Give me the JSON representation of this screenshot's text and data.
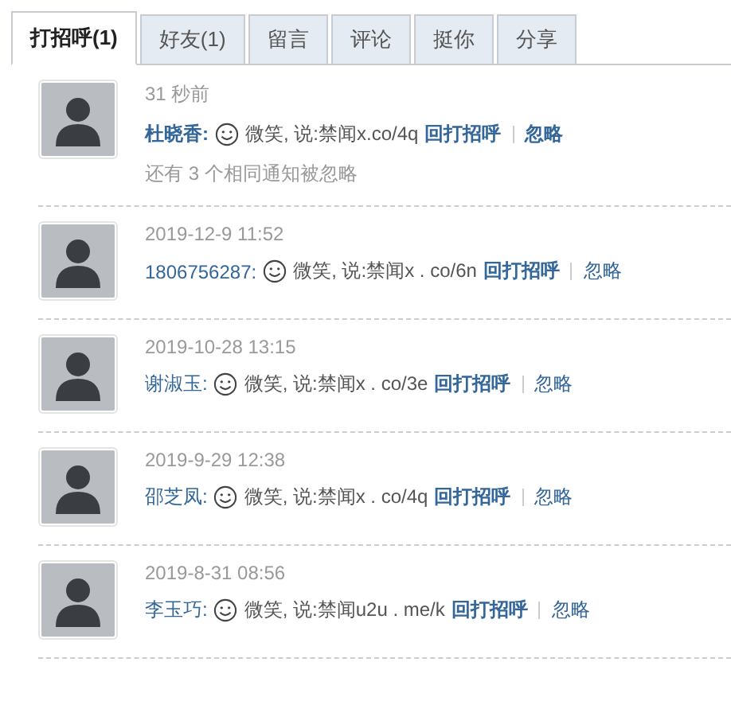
{
  "tabs": [
    {
      "label": "打招呼(1)",
      "selected": true
    },
    {
      "label": "好友(1)",
      "selected": false
    },
    {
      "label": "留言",
      "selected": false
    },
    {
      "label": "评论",
      "selected": false
    },
    {
      "label": "挺你",
      "selected": false
    },
    {
      "label": "分享",
      "selected": false
    }
  ],
  "notifications": [
    {
      "time": "31 秒前",
      "name": "杜晓香:",
      "message": "微笑, 说:禁闻x.co/4q",
      "reply": "回打招呼",
      "ignore": "忽略",
      "unread": true,
      "note": "还有 3 个相同通知被忽略"
    },
    {
      "time": "2019-12-9 11:52",
      "name": "1806756287:",
      "message": "微笑, 说:禁闻x . co/6n",
      "reply": "回打招呼",
      "ignore": "忽略",
      "unread": false
    },
    {
      "time": "2019-10-28 13:15",
      "name": "谢淑玉:",
      "message": "微笑, 说:禁闻x . co/3e",
      "reply": "回打招呼",
      "ignore": "忽略",
      "unread": false
    },
    {
      "time": "2019-9-29 12:38",
      "name": "邵芝凤:",
      "message": "微笑, 说:禁闻x . co/4q",
      "reply": "回打招呼",
      "ignore": "忽略",
      "unread": false
    },
    {
      "time": "2019-8-31 08:56",
      "name": "李玉巧:",
      "message": "微笑, 说:禁闻u2u . me/k",
      "reply": "回打招呼",
      "ignore": "忽略",
      "unread": false
    }
  ]
}
